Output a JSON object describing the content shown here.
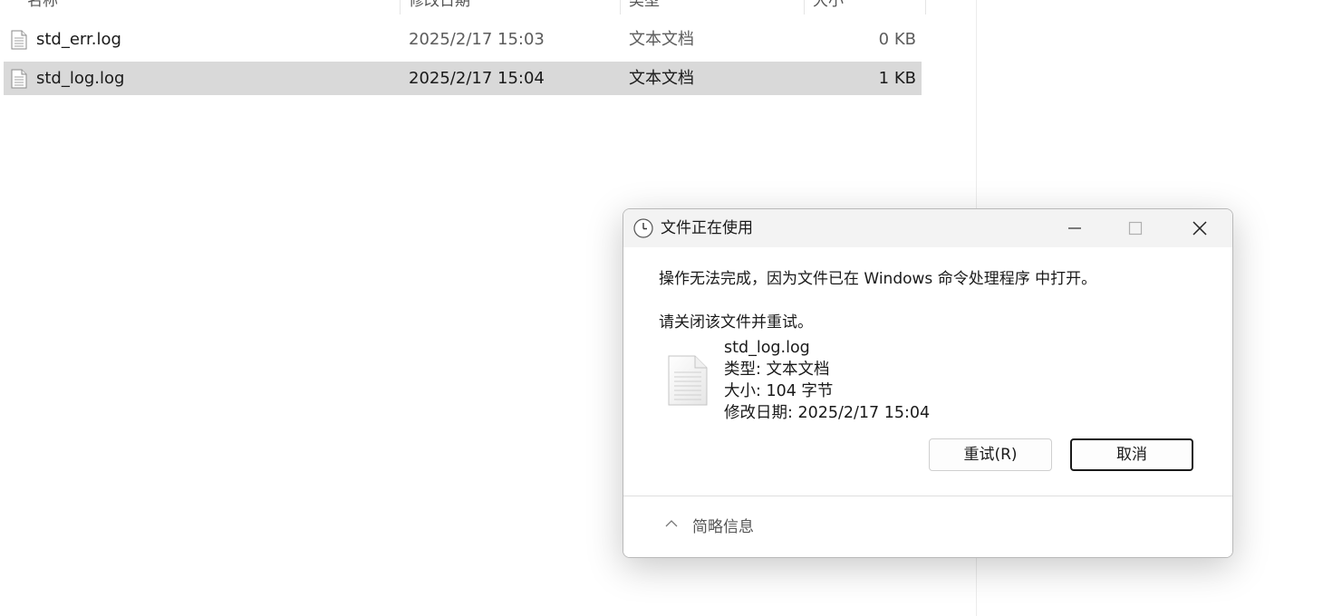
{
  "explorer": {
    "columns": {
      "name": "名称",
      "modified": "修改日期",
      "type": "类型",
      "size": "大小"
    },
    "files": [
      {
        "name": "std_err.log",
        "modified": "2025/2/17 15:03",
        "type": "文本文档",
        "size": "0 KB",
        "selected": false
      },
      {
        "name": "std_log.log",
        "modified": "2025/2/17 15:04",
        "type": "文本文档",
        "size": "1 KB",
        "selected": true
      }
    ]
  },
  "dialog": {
    "title": "文件正在使用",
    "message": "操作无法完成，因为文件已在 Windows 命令处理程序 中打开。",
    "instruction": "请关闭该文件并重试。",
    "file": {
      "name": "std_log.log",
      "type_line": "类型: 文本文档",
      "size_line": "大小: 104 字节",
      "modified_line": "修改日期: 2025/2/17 15:04"
    },
    "buttons": {
      "retry": "重试(R)",
      "cancel": "取消"
    },
    "details_toggle": "简略信息",
    "icons": {
      "title": "clock-icon",
      "file": "text-document-icon",
      "minimize": "minimize-icon",
      "maximize": "maximize-icon",
      "close": "close-icon",
      "details": "chevron-up-icon"
    }
  }
}
